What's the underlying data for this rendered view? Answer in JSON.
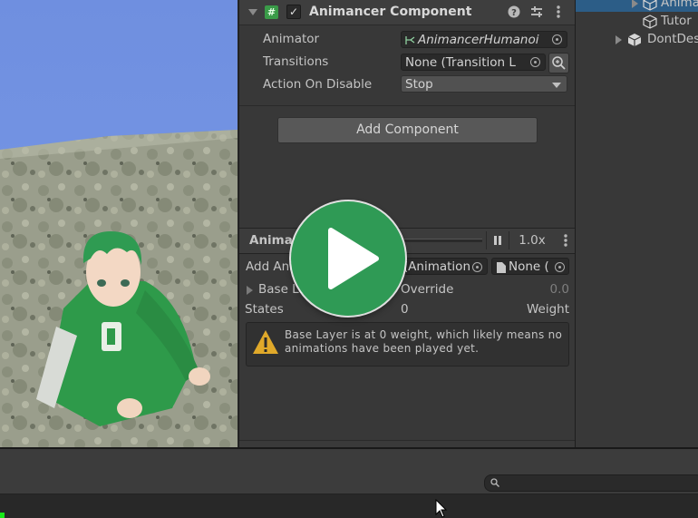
{
  "inspector": {
    "component_title": "Animancer Component",
    "component_icon": "#",
    "enabled_mark": "✓",
    "properties": [
      {
        "label": "Animator",
        "value": "AnimancerHumanoi"
      },
      {
        "label": "Transitions",
        "value": "None (Transition L"
      },
      {
        "label": "Action On Disable",
        "value": "Stop"
      }
    ],
    "add_component_label": "Add Component"
  },
  "animancer_window": {
    "title": "Animancer",
    "speed": "1.0x",
    "add_animation_label": "Add Animation",
    "add_animation_value": "None (Animation",
    "second_field_value": "None (",
    "layer": {
      "name": "Base Layer",
      "mode": "Override",
      "weight": "0.0"
    },
    "states": {
      "label": "States",
      "count": "0",
      "weight_label": "Weight"
    },
    "warning": "Base Layer is at 0 weight, which likely means no animations have been played yet."
  },
  "hierarchy": {
    "items": [
      {
        "label": "Anima"
      },
      {
        "label": "Tutor"
      },
      {
        "label": "DontDes"
      }
    ]
  },
  "colors": {
    "accent_green": "#2f9a55",
    "scene_sky": "#7a9ae6",
    "character_green": "#2e9a4a"
  },
  "icons": [
    "script-icon",
    "checkbox-icon",
    "help-icon",
    "preset-icon",
    "menu-icon",
    "object-picker-icon",
    "search-icon",
    "pause-icon",
    "warning-icon",
    "play-icon",
    "cursor-icon"
  ]
}
